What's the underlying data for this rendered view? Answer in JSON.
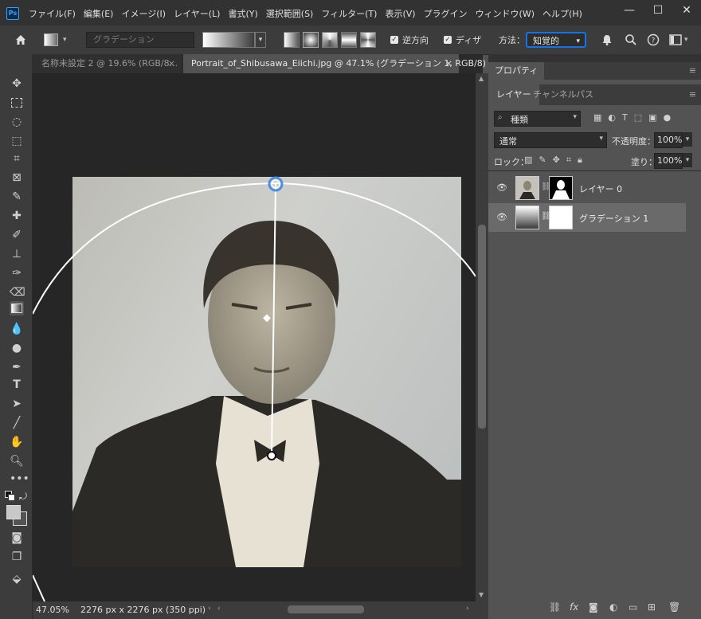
{
  "app": {
    "logo": "Ps"
  },
  "menu": {
    "items": [
      "ファイル(F)",
      "編集(E)",
      "イメージ(I)",
      "レイヤー(L)",
      "書式(Y)",
      "選択範囲(S)",
      "フィルター(T)",
      "表示(V)",
      "プラグイン",
      "ウィンドウ(W)",
      "ヘルプ(H)"
    ]
  },
  "window_controls": {
    "minimize": "—",
    "maximize": "☐",
    "close": "✕"
  },
  "options": {
    "gradient_preset": "グラデーション",
    "reverse_label": "逆方向",
    "dither_label": "ディザ",
    "method_label": "方法：",
    "method_value": "知覚的"
  },
  "tabs": [
    {
      "label": "名称未設定 2 @ 19.6% (RGB/8...",
      "close": "×"
    },
    {
      "label": "Portrait_of_Shibusawa_Eiichi.jpg @ 47.1% (グラデーション 1, RGB/8) *",
      "close": "×"
    }
  ],
  "status": {
    "zoom": "47.05%",
    "doc_info": "2276 px x 2276 px (350 ppi)"
  },
  "panels": {
    "properties_tab": "プロパティ",
    "layer_tabs": [
      "レイヤー",
      "チャンネル",
      "パス"
    ],
    "filter_kind": "種類",
    "blend_mode": "通常",
    "opacity_label": "不透明度：",
    "opacity_value": "100%",
    "lock_label": "ロック：",
    "fill_label": "塗り：",
    "fill_value": "100%"
  },
  "layers": [
    {
      "name": "レイヤー 0"
    },
    {
      "name": "グラデーション 1"
    }
  ],
  "colors": {
    "accent": "#1473e6",
    "brand": "#31a8ff"
  }
}
